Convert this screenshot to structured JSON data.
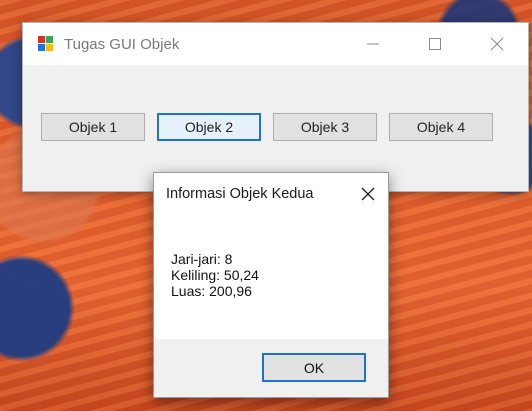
{
  "main_window": {
    "title": "Tugas GUI Objek",
    "icon": "app-window-icon",
    "controls": {
      "minimize_icon": "minimize-icon",
      "maximize_icon": "maximize-icon",
      "close_icon": "close-icon"
    },
    "buttons": [
      {
        "label": "Objek 1"
      },
      {
        "label": "Objek 2"
      },
      {
        "label": "Objek 3"
      },
      {
        "label": "Objek 4"
      }
    ],
    "focused_button": "Objek 2"
  },
  "dialog": {
    "title": "Informasi Objek Kedua",
    "close_icon": "close-icon",
    "lines": [
      "Jari-jari: 8",
      "Keliling: 50,24",
      "Luas: 200,96"
    ],
    "ok_label": "OK"
  },
  "colors": {
    "accent_focus": "#1e73c8",
    "window_bg": "#f0f0f0",
    "desktop_orange": "#e2612f"
  }
}
